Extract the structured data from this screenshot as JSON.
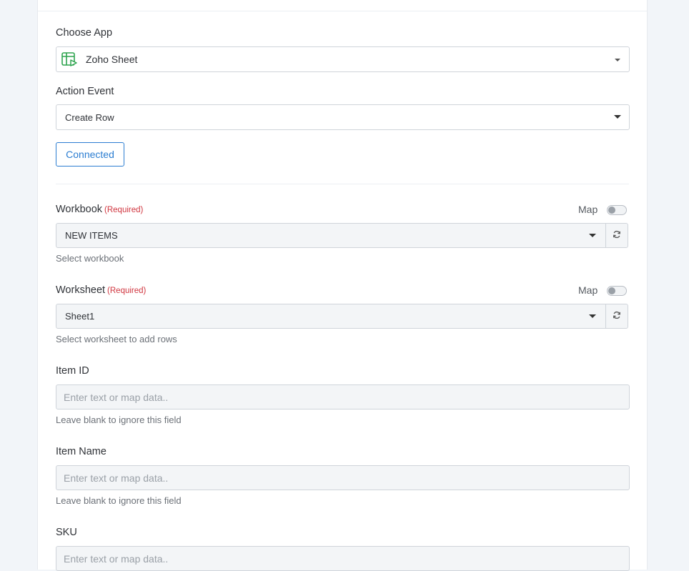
{
  "choose_app": {
    "label": "Choose App",
    "selected": "Zoho Sheet",
    "icon": "zoho-sheet-icon"
  },
  "action_event": {
    "label": "Action Event",
    "selected": "Create Row"
  },
  "connection": {
    "button_label": "Connected"
  },
  "workbook": {
    "label": "Workbook",
    "required": "(Required)",
    "map_label": "Map",
    "selected": "NEW ITEMS",
    "hint": "Select workbook"
  },
  "worksheet": {
    "label": "Worksheet",
    "required": "(Required)",
    "map_label": "Map",
    "selected": "Sheet1",
    "hint": "Select worksheet to add rows"
  },
  "fields": [
    {
      "label": "Item ID",
      "placeholder": "Enter text or map data..",
      "hint": "Leave blank to ignore this field"
    },
    {
      "label": "Item Name",
      "placeholder": "Enter text or map data..",
      "hint": "Leave blank to ignore this field"
    },
    {
      "label": "SKU",
      "placeholder": "Enter text or map data.."
    }
  ],
  "colors": {
    "accent": "#2b7dd1",
    "required": "#d0353f",
    "app_icon": "#2ea44f"
  }
}
